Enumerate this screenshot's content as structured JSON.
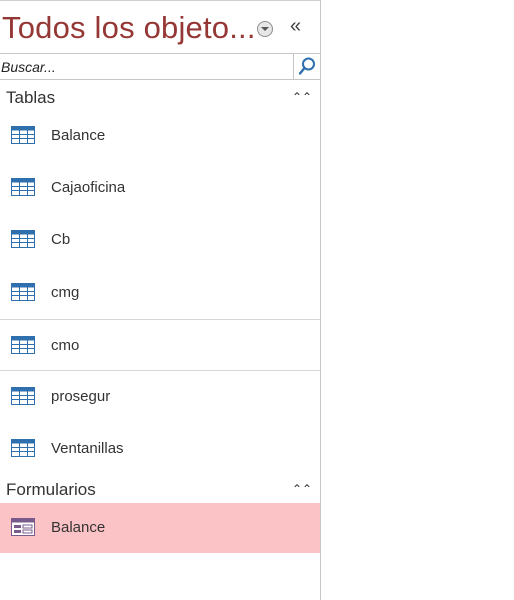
{
  "nav_pane": {
    "title": "Todos los objeto...",
    "search": {
      "placeholder": "Buscar..."
    },
    "groups": [
      {
        "label": "Tablas",
        "items": [
          {
            "label": "Balance",
            "icon": "table-icon"
          },
          {
            "label": "Cajaoficina",
            "icon": "table-icon"
          },
          {
            "label": "Cb",
            "icon": "table-icon"
          },
          {
            "label": "cmg",
            "icon": "table-icon"
          },
          {
            "label": "cmo",
            "icon": "table-icon"
          },
          {
            "label": "prosegur",
            "icon": "table-icon"
          },
          {
            "label": "Ventanillas",
            "icon": "table-icon"
          }
        ]
      },
      {
        "label": "Formularios",
        "items": [
          {
            "label": "Balance",
            "icon": "form-icon",
            "selected": true
          }
        ]
      }
    ]
  },
  "colors": {
    "title": "#953735",
    "selected_bg": "#fcc3c6",
    "icon_blue": "#2f6fae"
  }
}
